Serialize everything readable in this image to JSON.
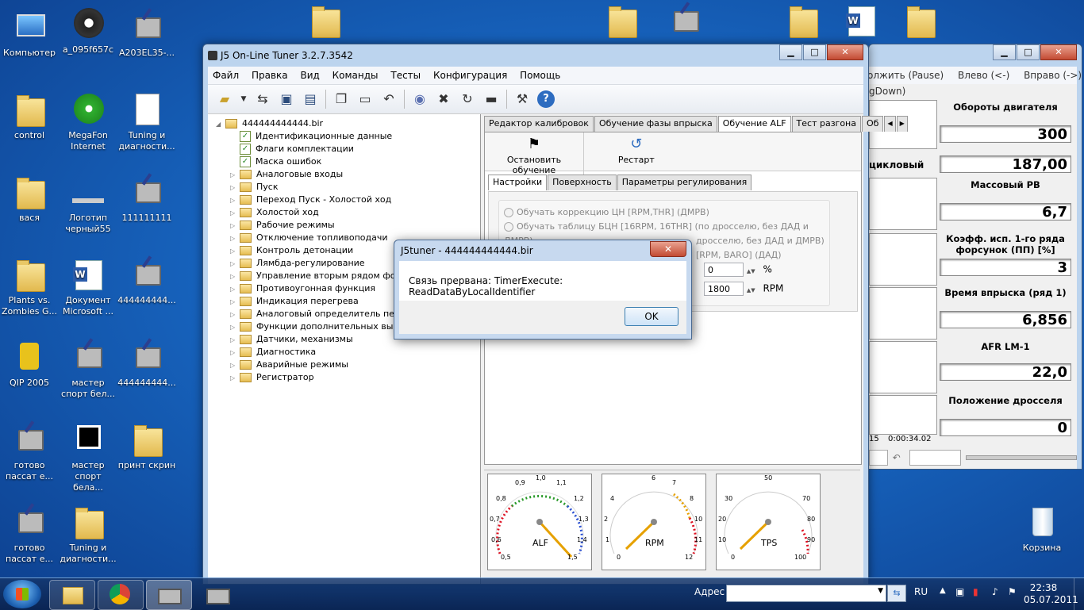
{
  "desktop": {
    "icons": [
      {
        "label": "Компьютер"
      },
      {
        "label": "a_095f657c"
      },
      {
        "label": "A203EL35-..."
      },
      {
        "label": "control"
      },
      {
        "label": "MegaFon Internet"
      },
      {
        "label": "Tuning и диагности..."
      },
      {
        "label": "вася"
      },
      {
        "label": "Логотип черный55"
      },
      {
        "label": "111111111"
      },
      {
        "label": "Plants vs. Zombies G..."
      },
      {
        "label": "Документ Microsoft ..."
      },
      {
        "label": "444444444..."
      },
      {
        "label": "QIP 2005"
      },
      {
        "label": "мастер спорт бел..."
      },
      {
        "label": "444444444..."
      },
      {
        "label": "готово пассат е..."
      },
      {
        "label": "мастер спорт бела..."
      },
      {
        "label": "принт скрин"
      },
      {
        "label": "готово пассат е..."
      },
      {
        "label": "Tuning и диагности..."
      },
      {
        "label": "Корзина"
      }
    ]
  },
  "window": {
    "title": "J5 On-Line Tuner 3.2.7.3542",
    "menu": [
      "Файл",
      "Правка",
      "Вид",
      "Команды",
      "Тесты",
      "Конфигурация",
      "Помощь"
    ],
    "tree": {
      "root": "444444444444.bir",
      "items": [
        {
          "label": "Идентификационные данные",
          "type": "check"
        },
        {
          "label": "Флаги комплектации",
          "type": "check"
        },
        {
          "label": "Маска ошибок",
          "type": "check"
        },
        {
          "label": "Аналоговые входы",
          "type": "folder"
        },
        {
          "label": "Пуск",
          "type": "folder"
        },
        {
          "label": "Переход Пуск - Холостой ход",
          "type": "folder"
        },
        {
          "label": "Холостой ход",
          "type": "folder"
        },
        {
          "label": "Рабочие режимы",
          "type": "folder"
        },
        {
          "label": "Отключение топливоподачи",
          "type": "folder"
        },
        {
          "label": "Контроль детонации",
          "type": "folder"
        },
        {
          "label": "Лямбда-регулирование",
          "type": "folder"
        },
        {
          "label": "Управление вторым рядом форс",
          "type": "folder"
        },
        {
          "label": "Противоугонная функция",
          "type": "folder"
        },
        {
          "label": "Индикация перегрева",
          "type": "folder"
        },
        {
          "label": "Аналоговый определитель перед",
          "type": "folder"
        },
        {
          "label": "Функции дополнительных выход",
          "type": "folder"
        },
        {
          "label": "Датчики, механизмы",
          "type": "folder"
        },
        {
          "label": "Диагностика",
          "type": "folder"
        },
        {
          "label": "Аварийные режимы",
          "type": "folder"
        },
        {
          "label": "Регистратор",
          "type": "folder"
        }
      ]
    },
    "tabs": [
      "Редактор калибровок",
      "Обучение фазы впрыска",
      "Обучение ALF",
      "Тест разгона",
      "Об"
    ],
    "actions": {
      "stop_label": "Остановить обучение",
      "restart_label": "Рестарт"
    },
    "subtabs": [
      "Настройки",
      "Поверхность",
      "Параметры регулирования"
    ],
    "options": [
      "Обучать коррекцию ЦН [RPM,THR] (ДМРВ)",
      "Обучать таблицу БЦН [16RPM, 16THR] (по дросселю, без ДАД и ДМРВ)",
      "дросселю, без ДАД и ДМРВ)",
      "[RPM, BARO] (ДАД)"
    ],
    "fields": {
      "percent_value": "0",
      "percent_unit": "%",
      "rpm_value": "1800",
      "rpm_unit": "RPM"
    },
    "gauges": [
      {
        "name": "ALF",
        "ticks": [
          "0,5",
          "0,6",
          "0,7",
          "0,8",
          "0,9",
          "1,0",
          "1,1",
          "1,2",
          "1,3",
          "1,4",
          "1,5"
        ]
      },
      {
        "name": "RPM",
        "ticks": [
          "0",
          "1",
          "2",
          "4",
          "6",
          "7",
          "8",
          "10",
          "11",
          "12"
        ]
      },
      {
        "name": "TPS",
        "ticks": [
          "0",
          "10",
          "20",
          "30",
          "50",
          "70",
          "80",
          "90",
          "100"
        ]
      }
    ]
  },
  "monitor": {
    "toolbar": [
      "олжить (Pause)",
      "Влево (<-)",
      "Вправо (->)"
    ],
    "sub": "gDown)",
    "metrics": [
      {
        "label": "Обороты двигателя",
        "value": "300"
      },
      {
        "label": "цикловый РВ",
        "value": "187,00"
      },
      {
        "label": "Массовый РВ",
        "value": "6,7"
      },
      {
        "label": "Коэфф. исп. 1-го ряда форсунок (ПП) [%]",
        "value": "3"
      },
      {
        "label": "Время впрыска (ряд 1)",
        "value": "6,856"
      },
      {
        "label": "AFR LM-1",
        "value": "22,0"
      },
      {
        "label": "Положение дросселя",
        "value": "0"
      }
    ],
    "time_left": "15",
    "time": "0:00:34.02"
  },
  "dialog": {
    "title": "J5tuner - 444444444444.bir",
    "message": "Связь прервана: TimerExecute: ReadDataByLocalIdentifier",
    "ok": "OK"
  },
  "taskbar": {
    "address_label": "Адрес",
    "lang": "RU",
    "time": "22:38",
    "date": "05.07.2011"
  }
}
